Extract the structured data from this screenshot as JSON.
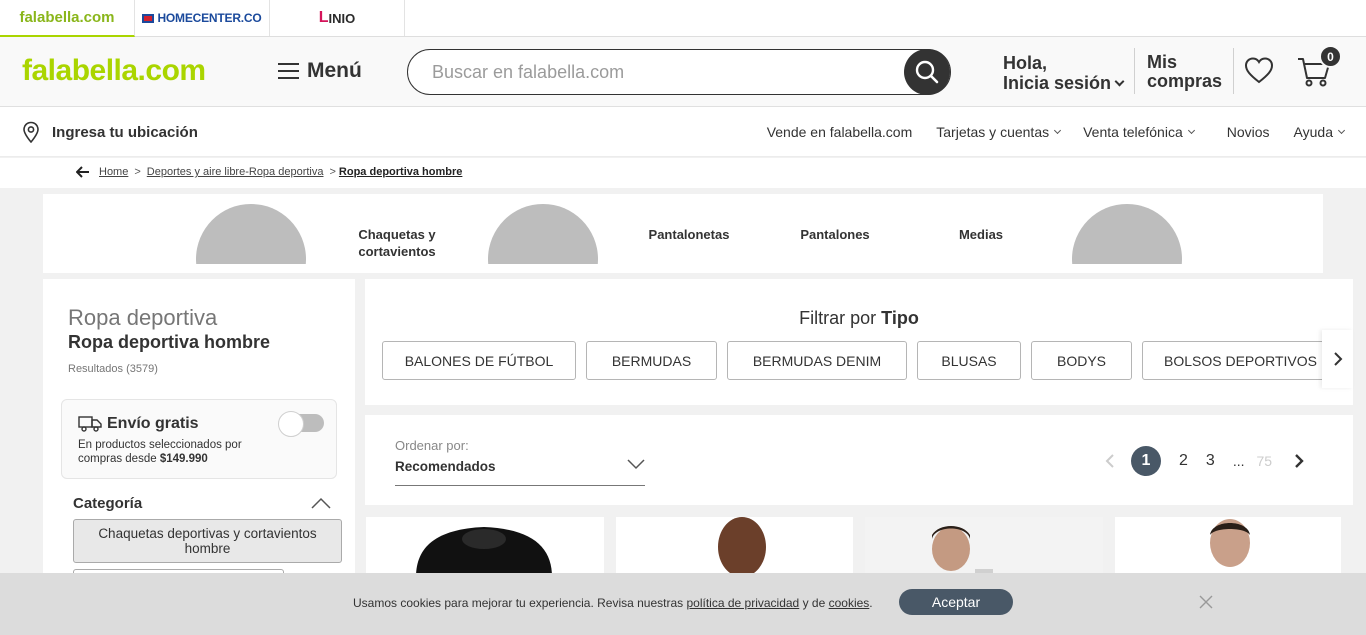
{
  "brand_tabs": {
    "falabella": "falabella.com",
    "homecenter": "HOMECENTER.CO",
    "linio": "INIO"
  },
  "header": {
    "logo": "falabella.com",
    "menu_label": "Menú",
    "search_placeholder": "Buscar en falabella.com",
    "greeting": "Hola,",
    "login": "Inicia sesión",
    "orders_line1": "Mis",
    "orders_line2": "compras",
    "cart_count": "0"
  },
  "subnav": {
    "location": "Ingresa tu ubicación",
    "links": [
      "Vende en falabella.com",
      "Tarjetas y cuentas",
      "Venta telefónica",
      "Novios",
      "Ayuda"
    ]
  },
  "breadcrumb": {
    "home": "Home",
    "parent": "Deportes y aire libre-Ropa deportiva",
    "current": "Ropa deportiva hombre"
  },
  "carousel": {
    "titles": [
      "Chaquetas y cortavientos",
      "Pantalonetas",
      "Pantalones",
      "Medias"
    ]
  },
  "sidebar": {
    "title": "Ropa deportiva",
    "subtitle": "Ropa deportiva hombre",
    "results": "Resultados (3579)",
    "shipping_title": "Envío gratis",
    "shipping_desc": "En productos seleccionados por compras desde",
    "shipping_amount": "$149.990",
    "category_heading": "Categoría",
    "category_item": "Chaquetas deportivas y cortavientos hombre"
  },
  "filter": {
    "label": "Filtrar por",
    "label_bold": "Tipo",
    "chips": [
      "BALONES DE FÚTBOL",
      "BERMUDAS",
      "BERMUDAS DENIM",
      "BLUSAS",
      "BODYS",
      "BOLSOS DEPORTIVOS"
    ]
  },
  "sort": {
    "label": "Ordenar por:",
    "value": "Recomendados"
  },
  "pagination": {
    "pages": [
      "1",
      "2",
      "3"
    ],
    "ellipsis": "...",
    "last": "75"
  },
  "cookie": {
    "text_before": "Usamos cookies para mejorar tu experiencia. Revisa nuestras",
    "privacy_link": "política de privacidad",
    "connector": "y de",
    "cookies_link": "cookies",
    "text_after": ".",
    "accept": "Aceptar"
  },
  "colors": {
    "brand_green": "#aad500",
    "dark": "#333333",
    "slate": "#495867"
  }
}
